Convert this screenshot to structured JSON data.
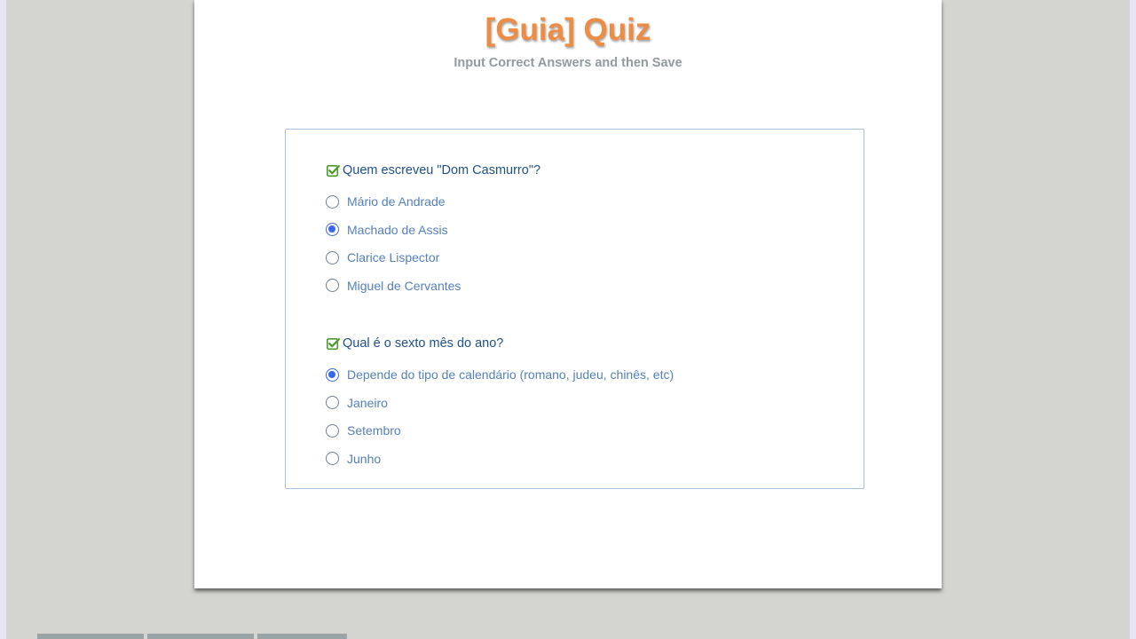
{
  "page": {
    "title": "[Guia] Quiz",
    "subtitle": "Input Correct Answers and then Save"
  },
  "questions": [
    {
      "text": "Quem escreveu \"Dom Casmurro\"?",
      "icon": "checked-checkbox-icon",
      "options": [
        {
          "label": "Mário de Andrade",
          "selected": false
        },
        {
          "label": "Machado de Assis",
          "selected": true
        },
        {
          "label": "Clarice Lispector",
          "selected": false
        },
        {
          "label": "Miguel de Cervantes",
          "selected": false
        }
      ]
    },
    {
      "text": "Qual é o sexto mês do ano?",
      "icon": "checked-checkbox-icon",
      "options": [
        {
          "label": "Depende do tipo de calendário (romano, judeu, chinês, etc)",
          "selected": true
        },
        {
          "label": "Janeiro",
          "selected": false
        },
        {
          "label": "Setembro",
          "selected": false
        },
        {
          "label": "Junho",
          "selected": false
        }
      ]
    }
  ],
  "colors": {
    "title": "#ec8c45",
    "question_text": "#1f4f86",
    "option_text": "#5580ba",
    "radio_selected": "#3a67e8",
    "check_icon": "#4b9a2a",
    "background": "#d4d4d0"
  }
}
